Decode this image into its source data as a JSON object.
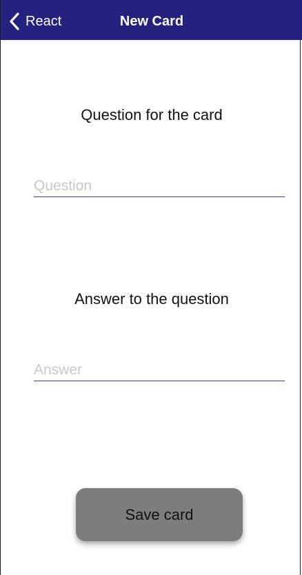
{
  "navbar": {
    "back_label": "React",
    "title": "New Card",
    "back_icon": "chevron-left-icon",
    "background_color": "#24217f"
  },
  "form": {
    "question_label": "Question for the card",
    "question_placeholder": "Question",
    "question_value": "",
    "answer_label": "Answer to the question",
    "answer_placeholder": "Answer",
    "answer_value": "",
    "underline_color": "#3a36b8"
  },
  "actions": {
    "save_label": "Save card",
    "save_color": "#7d7d7d"
  }
}
